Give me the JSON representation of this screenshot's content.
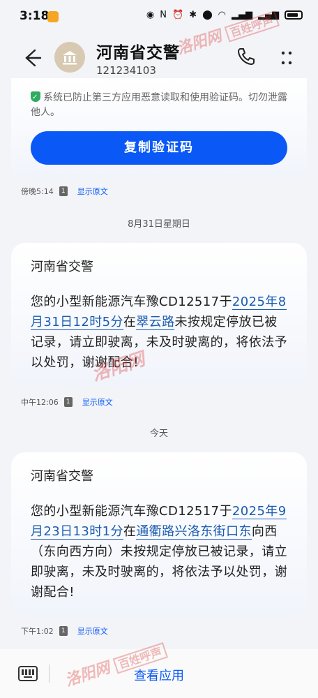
{
  "status": {
    "time": "3:18",
    "signal": "5G"
  },
  "header": {
    "contact_name": "河南省交警",
    "contact_number": "121234103"
  },
  "first_message": {
    "security_note": "系统已防止第三方应用恶意读取和使用验证码。切勿泄露他人。",
    "copy_button": "复制验证码",
    "time": "傍晚5:14",
    "sim": "1",
    "show_original": "显示原文"
  },
  "date_separator_1": "8月31日星期日",
  "second_message": {
    "title": "河南省交警",
    "body_1": "您的小型新能源汽车豫CD12517于",
    "link_1": "2025年8月31日12时5分",
    "body_2": "在",
    "link_2": "翠云路",
    "body_3": "未按规定停放已被记录，请立即驶离，未及时驶离的，将依法予以处罚，谢谢配合!",
    "time": "中午12:06",
    "sim": "1",
    "show_original": "显示原文"
  },
  "date_separator_2": "今天",
  "third_message": {
    "title": "河南省交警",
    "body_1": "您的小型新能源汽车豫CD12517于",
    "link_1": "2025年9月23日13时1分",
    "body_2": "在",
    "link_2": "通衢路兴洛东街口东",
    "body_3": "向西（东向西方向）未按规定停放已被记录，请立即驶离，未及时驶离的，将依法予以处罚，谢谢配合!",
    "time": "下午1:02",
    "sim": "1",
    "show_original": "显示原文"
  },
  "bottom_bar": {
    "view_app": "查看应用"
  },
  "watermarks": {
    "site": "洛阳网",
    "tag": "百姓呼声"
  },
  "colors": {
    "accent": "#0a59f7",
    "link": "#1b5cb0",
    "background": "#f3f4f8"
  }
}
